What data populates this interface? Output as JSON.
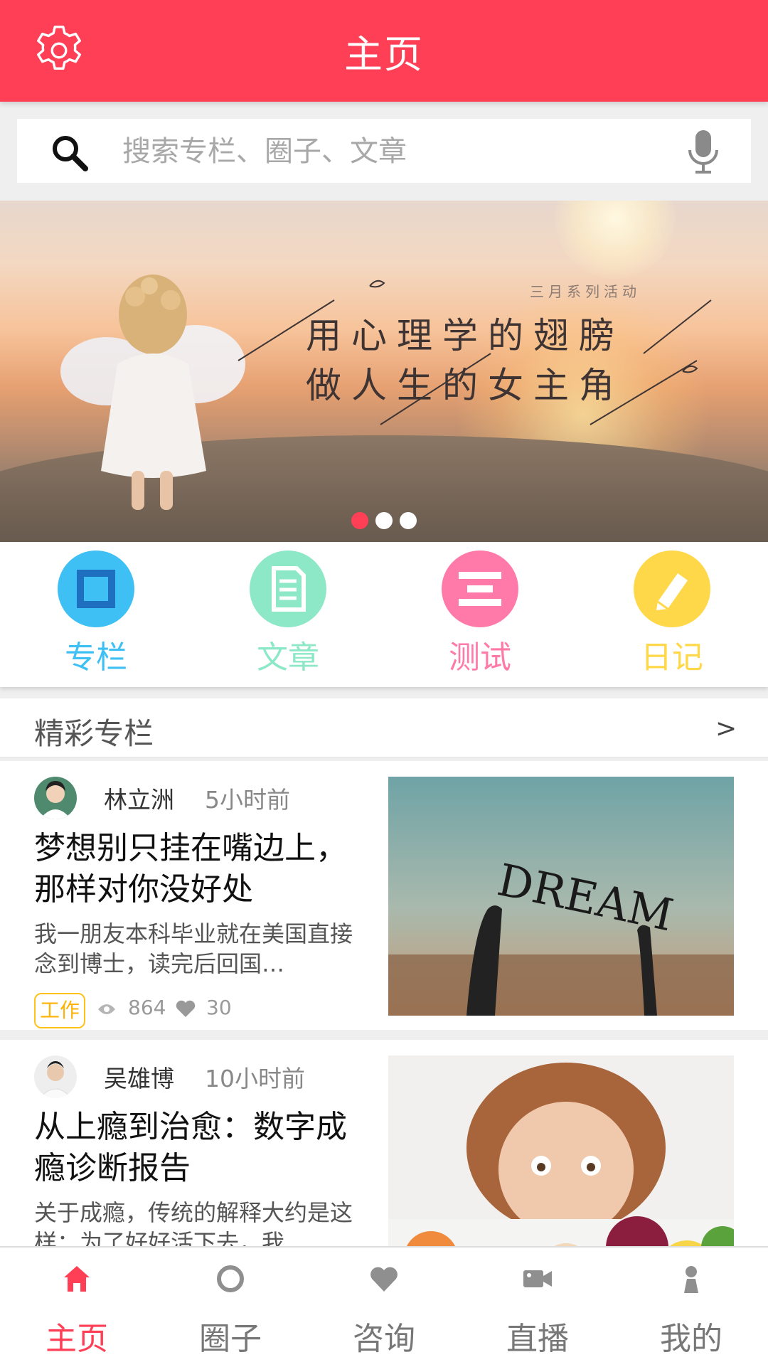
{
  "header": {
    "title": "主页",
    "settings_icon": "gear-icon"
  },
  "search": {
    "placeholder": "搜索专栏、圈子、文章",
    "search_icon": "search-icon",
    "voice_icon": "microphone-icon"
  },
  "banner": {
    "subtitle": "三月系列活动",
    "line1": "用心理学的翅膀",
    "line2": "做人生的女主角",
    "slide_count": 3,
    "active_slide": 1
  },
  "categories": [
    {
      "label": "专栏",
      "icon": "column-square-icon",
      "color": "#3ec0f5"
    },
    {
      "label": "文章",
      "icon": "article-document-icon",
      "color": "#8ce8c6"
    },
    {
      "label": "测试",
      "icon": "test-list-icon",
      "color": "#ff7aa8"
    },
    {
      "label": "日记",
      "icon": "diary-pencil-icon",
      "color": "#ffd84a"
    }
  ],
  "section": {
    "title": "精彩专栏",
    "more": ">"
  },
  "articles": [
    {
      "author": "林立洲",
      "time": "5小时前",
      "title": "梦想别只挂在嘴边上，那样对你没好处",
      "excerpt": "我一朋友本科毕业就在美国直接念到博士，读完后回国…",
      "tag": "工作",
      "views": "864",
      "likes": "30",
      "image_text": "DREAM"
    },
    {
      "author": "吴雄博",
      "time": "10小时前",
      "title": "从上瘾到治愈：数字成瘾诊断报告",
      "excerpt": "关于成瘾，传统的解释大约是这样：为了好好活下去，我…"
    }
  ],
  "bottom_nav": [
    {
      "label": "主页",
      "icon": "home-icon"
    },
    {
      "label": "圈子",
      "icon": "circle-icon"
    },
    {
      "label": "咨询",
      "icon": "heart-icon"
    },
    {
      "label": "直播",
      "icon": "video-camera-icon"
    },
    {
      "label": "我的",
      "icon": "person-icon"
    }
  ],
  "colors": {
    "primary": "#ff3f55",
    "tag": "#ffb300"
  }
}
